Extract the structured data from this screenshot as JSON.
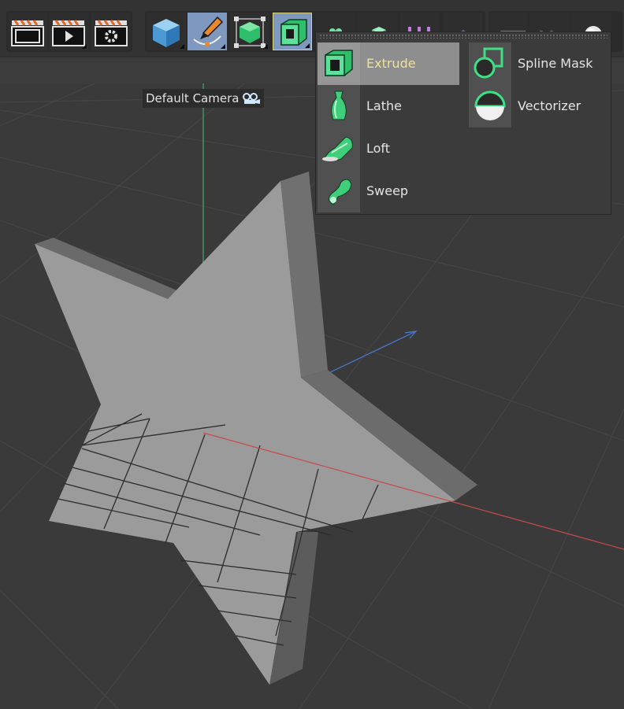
{
  "toolbar": {
    "buttons": [
      {
        "name": "render-view-button",
        "icon": "clapper-viewport-icon"
      },
      {
        "name": "render-to-picture-viewer-button",
        "icon": "clapper-play-icon"
      },
      {
        "name": "render-settings-button",
        "icon": "clapper-gear-icon"
      },
      {
        "name": "cube-button",
        "icon": "cube-icon"
      },
      {
        "name": "pen-spline-button",
        "icon": "pen-spline-icon"
      },
      {
        "name": "subdivision-surface-button",
        "icon": "subdivision-cube-icon"
      },
      {
        "name": "extrude-generator-button",
        "icon": "extrude-icon",
        "selected": true
      },
      {
        "name": "cloner-button",
        "icon": "cloner-icon"
      },
      {
        "name": "deformer-button",
        "icon": "deformer-icon"
      },
      {
        "name": "field-button",
        "icon": "field-icon"
      },
      {
        "name": "environment-button",
        "icon": "floor-icon"
      },
      {
        "name": "camera-button",
        "icon": "camera-icon"
      },
      {
        "name": "light-button",
        "icon": "light-icon"
      }
    ]
  },
  "viewport": {
    "camera_label": "Default Camera",
    "camera_icon": "camera-icon",
    "colors": {
      "background": "#3a3a3a",
      "grid": "#4a4a4a",
      "axis_x": "#c94a4a",
      "axis_y": "#4aa86a",
      "axis_z": "#4a7ad0",
      "star_face": "#9b9b9b"
    }
  },
  "generator_menu": {
    "accent_color": "#f0e28e",
    "items": [
      {
        "label": "Extrude",
        "icon": "extrude-icon",
        "highlighted": true
      },
      {
        "label": "Lathe",
        "icon": "lathe-icon"
      },
      {
        "label": "Loft",
        "icon": "loft-icon"
      },
      {
        "label": "Sweep",
        "icon": "sweep-icon"
      },
      {
        "label": "Spline Mask",
        "icon": "spline-mask-icon"
      },
      {
        "label": "Vectorizer",
        "icon": "vectorizer-icon"
      }
    ]
  }
}
